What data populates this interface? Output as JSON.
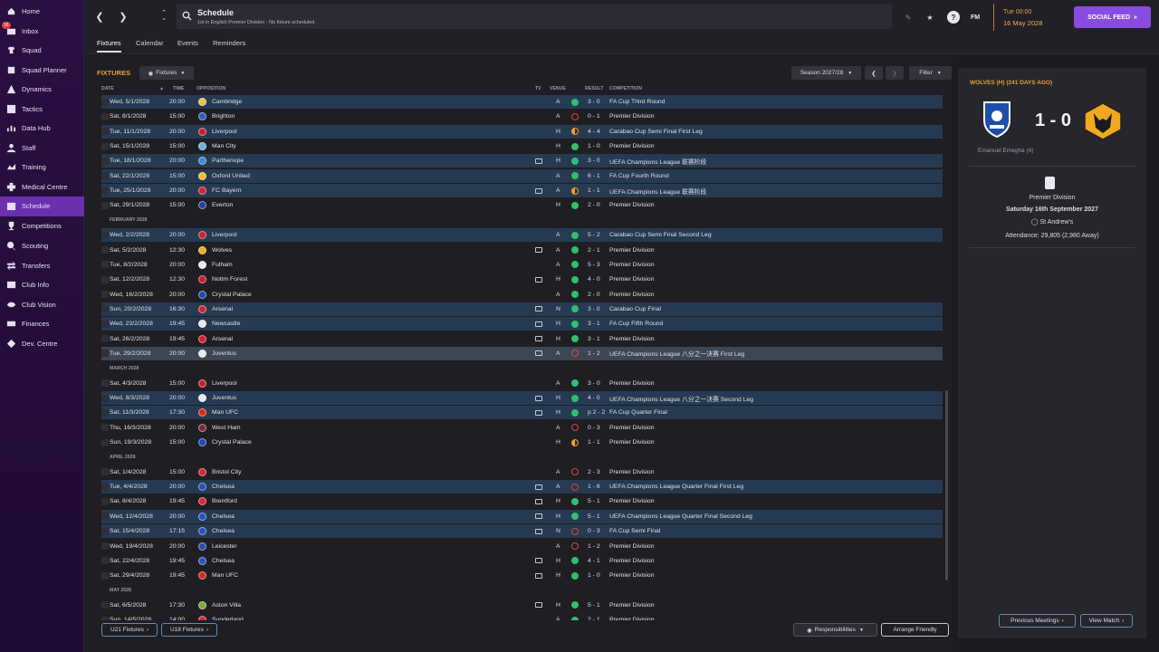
{
  "sidebar": {
    "inbox_badge": "16",
    "items": [
      {
        "label": "Home",
        "icon": "home-icon"
      },
      {
        "label": "Inbox",
        "icon": "inbox-icon"
      },
      {
        "label": "Squad",
        "icon": "squad-icon"
      },
      {
        "label": "Squad Planner",
        "icon": "squad-planner-icon"
      },
      {
        "label": "Dynamics",
        "icon": "dynamics-icon"
      },
      {
        "label": "Tactics",
        "icon": "tactics-icon"
      },
      {
        "label": "Data Hub",
        "icon": "data-hub-icon"
      },
      {
        "label": "Staff",
        "icon": "staff-icon"
      },
      {
        "label": "Training",
        "icon": "training-icon"
      },
      {
        "label": "Medical Centre",
        "icon": "medical-icon"
      },
      {
        "label": "Schedule",
        "icon": "schedule-icon"
      },
      {
        "label": "Competitions",
        "icon": "trophy-icon"
      },
      {
        "label": "Scouting",
        "icon": "scouting-icon"
      },
      {
        "label": "Transfers",
        "icon": "transfers-icon"
      },
      {
        "label": "Club Info",
        "icon": "club-info-icon"
      },
      {
        "label": "Club Vision",
        "icon": "club-vision-icon"
      },
      {
        "label": "Finances",
        "icon": "finances-icon"
      },
      {
        "label": "Dev. Centre",
        "icon": "dev-centre-icon"
      }
    ]
  },
  "header": {
    "title": "Schedule",
    "subtitle": "1st in English Premier Division - No fixture scheduled.",
    "fm_label": "FM",
    "date_time": "Tue 00:00",
    "date": "16 May 2028",
    "social_feed": "SOCIAL FEED"
  },
  "tabs": [
    "Fixtures",
    "Calendar",
    "Events",
    "Reminders"
  ],
  "fixtures": {
    "title": "FIXTURES",
    "view_dropdown": "Fixtures",
    "season": "Season 2027/28",
    "filter": "Filter",
    "columns": {
      "date": "DATE",
      "time": "TIME",
      "opposition": "OPPOSITION",
      "tv": "TV",
      "venue": "VENUE",
      "result": "RESULT",
      "competition": "COMPETITION"
    },
    "rows": [
      {
        "date": "Wed, 5/1/2028",
        "time": "20:00",
        "opp": "Cambridge",
        "tv": false,
        "venue": "A",
        "res": "w",
        "score": "3 - 0",
        "comp": "FA Cup Third Round",
        "hl": true,
        "crest": "#e6c440"
      },
      {
        "date": "Sat, 8/1/2028",
        "time": "15:00",
        "opp": "Brighton",
        "tv": false,
        "venue": "A",
        "res": "l",
        "score": "0 - 1",
        "comp": "Premier Division",
        "hl": false,
        "crest": "#2a5fc0"
      },
      {
        "date": "Tue, 11/1/2028",
        "time": "20:00",
        "opp": "Liverpool",
        "tv": false,
        "venue": "H",
        "res": "d",
        "score": "4 - 4",
        "comp": "Carabao Cup Semi Final First Leg",
        "hl": true,
        "crest": "#c8202a"
      },
      {
        "date": "Sat, 15/1/2028",
        "time": "15:00",
        "opp": "Man City",
        "tv": false,
        "venue": "H",
        "res": "w",
        "score": "1 - 0",
        "comp": "Premier Division",
        "hl": false,
        "crest": "#6cb0e0"
      },
      {
        "date": "Tue, 18/1/2028",
        "time": "20:00",
        "opp": "Parthenope",
        "tv": true,
        "venue": "H",
        "res": "w",
        "score": "3 - 0",
        "comp": "UEFA Champions League 联赛阶段",
        "hl": true,
        "crest": "#3a8ad0"
      },
      {
        "date": "Sat, 22/1/2028",
        "time": "15:00",
        "opp": "Oxford United",
        "tv": false,
        "venue": "A",
        "res": "w",
        "score": "6 - 1",
        "comp": "FA Cup Fourth Round",
        "hl": true,
        "crest": "#e8c030"
      },
      {
        "date": "Tue, 25/1/2028",
        "time": "20:00",
        "opp": "FC Bayern",
        "tv": true,
        "venue": "A",
        "res": "d",
        "score": "1 - 1",
        "comp": "UEFA Champions League 联赛阶段",
        "hl": true,
        "crest": "#d0203a"
      },
      {
        "date": "Sat, 29/1/2028",
        "time": "15:00",
        "opp": "Everton",
        "tv": false,
        "venue": "H",
        "res": "w",
        "score": "2 - 0",
        "comp": "Premier Division",
        "hl": false,
        "crest": "#2a3f9a"
      },
      {
        "month": "FEBRUARY 2028"
      },
      {
        "date": "Wed, 2/2/2028",
        "time": "20:00",
        "opp": "Liverpool",
        "tv": false,
        "venue": "A",
        "res": "w",
        "score": "5 - 2",
        "comp": "Carabao Cup Semi Final Second Leg",
        "hl": true,
        "crest": "#c8202a"
      },
      {
        "date": "Sat, 5/2/2028",
        "time": "12:30",
        "opp": "Wolves",
        "tv": true,
        "venue": "A",
        "res": "w",
        "score": "2 - 1",
        "comp": "Premier Division",
        "hl": false,
        "crest": "#f0a820"
      },
      {
        "date": "Tue, 8/2/2028",
        "time": "20:00",
        "opp": "Fulham",
        "tv": false,
        "venue": "A",
        "res": "w",
        "score": "5 - 3",
        "comp": "Premier Division",
        "hl": false,
        "crest": "#e8e8e8"
      },
      {
        "date": "Sat, 12/2/2028",
        "time": "12:30",
        "opp": "Nottm Forest",
        "tv": true,
        "venue": "H",
        "res": "w",
        "score": "4 - 0",
        "comp": "Premier Division",
        "hl": false,
        "crest": "#c81c2a"
      },
      {
        "date": "Wed, 16/2/2028",
        "time": "20:00",
        "opp": "Crystal Palace",
        "tv": false,
        "venue": "A",
        "res": "w",
        "score": "2 - 0",
        "comp": "Premier Division",
        "hl": false,
        "crest": "#1a4ab0"
      },
      {
        "date": "Sun, 20/2/2028",
        "time": "16:30",
        "opp": "Arsenal",
        "tv": true,
        "venue": "N",
        "res": "w",
        "score": "3 - 0",
        "comp": "Carabao Cup Final",
        "hl": true,
        "crest": "#d8202a"
      },
      {
        "date": "Wed, 23/2/2028",
        "time": "19:45",
        "opp": "Newcastle",
        "tv": true,
        "venue": "H",
        "res": "w",
        "score": "3 - 1",
        "comp": "FA Cup Fifth Round",
        "hl": true,
        "crest": "#e8e8e8"
      },
      {
        "date": "Sat, 26/2/2028",
        "time": "19:45",
        "opp": "Arsenal",
        "tv": true,
        "venue": "H",
        "res": "w",
        "score": "3 - 1",
        "comp": "Premier Division",
        "hl": false,
        "crest": "#d8202a"
      },
      {
        "date": "Tue, 29/2/2028",
        "time": "20:00",
        "opp": "Juventus",
        "tv": true,
        "venue": "A",
        "res": "l",
        "score": "1 - 2",
        "comp": "UEFA Champions League 八分之一决赛 First Leg",
        "hl": false,
        "sel": true,
        "crest": "#e8e8e8"
      },
      {
        "month": "MARCH 2028"
      },
      {
        "date": "Sat, 4/3/2028",
        "time": "15:00",
        "opp": "Liverpool",
        "tv": false,
        "venue": "A",
        "res": "w",
        "score": "3 - 0",
        "comp": "Premier Division",
        "hl": false,
        "crest": "#c8202a"
      },
      {
        "date": "Wed, 8/3/2028",
        "time": "20:00",
        "opp": "Juventus",
        "tv": true,
        "venue": "H",
        "res": "w",
        "score": "4 - 0",
        "comp": "UEFA Champions League 八分之一决赛 Second Leg",
        "hl": true,
        "crest": "#e8e8e8"
      },
      {
        "date": "Sat, 11/3/2028",
        "time": "17:30",
        "opp": "Man UFC",
        "tv": true,
        "venue": "H",
        "res": "w",
        "score": "p 2 - 2",
        "comp": "FA Cup Quarter Final",
        "hl": true,
        "crest": "#d82a1a"
      },
      {
        "date": "Thu, 16/3/2028",
        "time": "20:00",
        "opp": "West Ham",
        "tv": false,
        "venue": "A",
        "res": "l",
        "score": "0 - 3",
        "comp": "Premier Division",
        "hl": false,
        "crest": "#7a2a3a"
      },
      {
        "date": "Sun, 19/3/2028",
        "time": "15:00",
        "opp": "Crystal Palace",
        "tv": false,
        "venue": "H",
        "res": "d",
        "score": "1 - 1",
        "comp": "Premier Division",
        "hl": false,
        "crest": "#1a4ab0"
      },
      {
        "month": "APRIL 2028"
      },
      {
        "date": "Sat, 1/4/2028",
        "time": "15:00",
        "opp": "Bristol City",
        "tv": false,
        "venue": "A",
        "res": "l",
        "score": "2 - 3",
        "comp": "Premier Division",
        "hl": false,
        "crest": "#d02a2a"
      },
      {
        "date": "Tue, 4/4/2028",
        "time": "20:00",
        "opp": "Chelsea",
        "tv": true,
        "venue": "A",
        "res": "l",
        "score": "1 - 6",
        "comp": "UEFA Champions League Quarter Final First Leg",
        "hl": true,
        "crest": "#2a50b8"
      },
      {
        "date": "Sat, 8/4/2028",
        "time": "19:45",
        "opp": "Brentford",
        "tv": true,
        "venue": "H",
        "res": "w",
        "score": "5 - 1",
        "comp": "Premier Division",
        "hl": false,
        "crest": "#d82a2a"
      },
      {
        "date": "Wed, 12/4/2028",
        "time": "20:00",
        "opp": "Chelsea",
        "tv": true,
        "venue": "H",
        "res": "w",
        "score": "5 - 1",
        "comp": "UEFA Champions League Quarter Final Second Leg",
        "hl": true,
        "crest": "#2a50b8"
      },
      {
        "date": "Sat, 15/4/2028",
        "time": "17:15",
        "opp": "Chelsea",
        "tv": true,
        "venue": "N",
        "res": "l",
        "score": "0 - 3",
        "comp": "FA Cup Semi Final",
        "hl": true,
        "crest": "#2a50b8"
      },
      {
        "date": "Wed, 19/4/2028",
        "time": "20:00",
        "opp": "Leicester",
        "tv": false,
        "venue": "A",
        "res": "l",
        "score": "1 - 2",
        "comp": "Premier Division",
        "hl": false,
        "crest": "#2a4ab0"
      },
      {
        "date": "Sat, 22/4/2028",
        "time": "19:45",
        "opp": "Chelsea",
        "tv": true,
        "venue": "H",
        "res": "w",
        "score": "4 - 1",
        "comp": "Premier Division",
        "hl": false,
        "crest": "#2a50b8"
      },
      {
        "date": "Sat, 29/4/2028",
        "time": "19:45",
        "opp": "Man UFC",
        "tv": true,
        "venue": "H",
        "res": "w",
        "score": "1 - 0",
        "comp": "Premier Division",
        "hl": false,
        "crest": "#d82a1a"
      },
      {
        "month": "MAY 2028"
      },
      {
        "date": "Sat, 6/5/2028",
        "time": "17:30",
        "opp": "Aston Villa",
        "tv": true,
        "venue": "H",
        "res": "w",
        "score": "5 - 1",
        "comp": "Premier Division",
        "hl": false,
        "crest": "#7aa83a"
      },
      {
        "date": "Sun, 14/5/2028",
        "time": "14:00",
        "opp": "Sunderland",
        "tv": false,
        "venue": "A",
        "res": "w",
        "score": "2 - 1",
        "comp": "Premier Division",
        "hl": false,
        "crest": "#d82a2a"
      }
    ],
    "u21_button": "U21 Fixtures",
    "u18_button": "U18 Fixtures",
    "responsibilities_button": "Responsibilities",
    "arrange_friendly_button": "Arrange Friendly"
  },
  "match_panel": {
    "title": "WOLVES (H) (241 DAYS AGO)",
    "score": "1 - 0",
    "scorer": "Emanuel Emegha (4)",
    "competition": "Premier Division",
    "date": "Saturday 16th September 2027",
    "stadium": "St Andrew's",
    "attendance": "Attendance: 29,805 (2,980 Away)",
    "prev_button": "Previous Meetings",
    "view_button": "View Match"
  },
  "colors": {
    "win": "#2fbf71",
    "loss": "#e0443a",
    "draw": "#e8a030",
    "accent": "#e8a030",
    "highlight": "#263a52"
  }
}
